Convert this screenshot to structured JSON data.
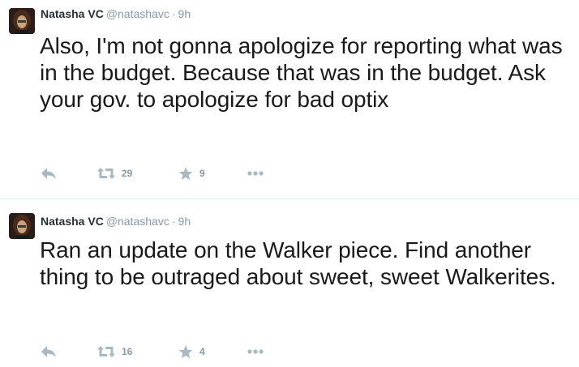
{
  "tweets": [
    {
      "fullname": "Natasha VC",
      "username": "@natashavc",
      "separator": "·",
      "time": "9h",
      "text": "Also, I'm not gonna apologize for reporting what was in the budget. Because that was in the budget. Ask your gov. to apologize for bad optix",
      "retweets": "29",
      "favorites": "9"
    },
    {
      "fullname": "Natasha VC",
      "username": "@natashavc",
      "separator": "·",
      "time": "9h",
      "text": "Ran an update on the Walker piece. Find another thing to be outraged about sweet, sweet Walkerites.",
      "retweets": "16",
      "favorites": "4"
    }
  ],
  "icons": {
    "reply": "reply-icon",
    "retweet": "retweet-icon",
    "favorite": "star-icon",
    "more": "more-icon"
  },
  "colors": {
    "icon": "#aab8c2",
    "count": "#8899a6",
    "divider": "#e1e8ed"
  }
}
